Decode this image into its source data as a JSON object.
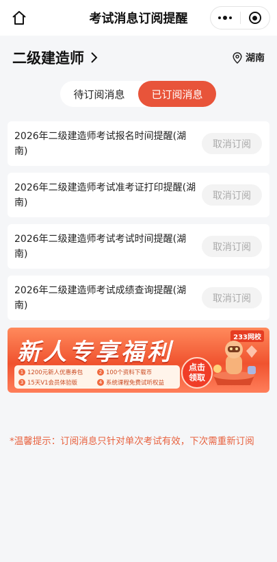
{
  "topbar": {
    "title": "考试消息订阅提醒",
    "home_icon": "home-icon",
    "more_icon": "more-dots-icon",
    "close_icon": "mini-program-close-icon"
  },
  "exam": {
    "name": "二级建造师",
    "region": "湖南"
  },
  "tabs": [
    {
      "label": "待订阅消息",
      "active": false
    },
    {
      "label": "已订阅消息",
      "active": true
    }
  ],
  "subscriptions": [
    {
      "text": "2026年二级建造师考试报名时间提醒(湖南)",
      "button": "取消订阅"
    },
    {
      "text": "2026年二级建造师考试准考证打印提醒(湖南)",
      "button": "取消订阅"
    },
    {
      "text": "2026年二级建造师考试考试时间提醒(湖南)",
      "button": "取消订阅"
    },
    {
      "text": "2026年二级建造师考试成绩查询提醒(湖南)",
      "button": "取消订阅"
    }
  ],
  "banner": {
    "heading": "新人专享福利",
    "brand": "233网校",
    "claim_line1": "点击",
    "claim_line2": "领取",
    "perks": [
      {
        "num": "1",
        "text": "1200元新人优惠券包"
      },
      {
        "num": "2",
        "text": "100个资料下载币"
      },
      {
        "num": "3",
        "text": "15天V1会员体验版"
      },
      {
        "num": "4",
        "text": "系统课程免费试听权益"
      }
    ]
  },
  "tip": "*温馨提示：订阅消息只针对单次考试有效，下次需重新订阅",
  "colors": {
    "accent": "#e8543a",
    "tip": "#e8623f",
    "button_bg": "#f3f3f3",
    "button_text": "#aaaaaa"
  }
}
